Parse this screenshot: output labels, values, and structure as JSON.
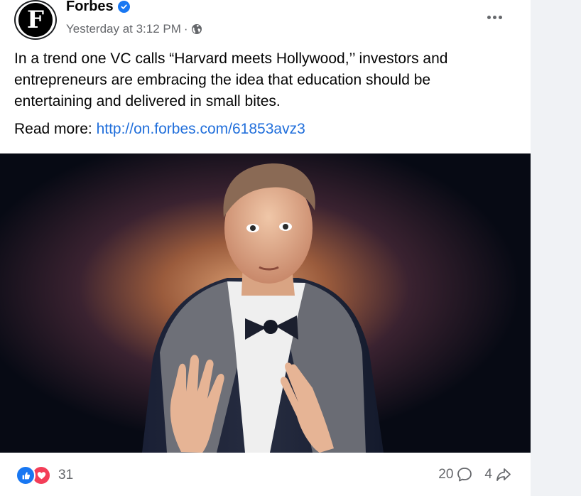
{
  "post": {
    "page_name": "Forbes",
    "avatar_letter": "F",
    "timestamp": "Yesterday at 3:12 PM",
    "separator": "·",
    "audience_icon": "globe-icon",
    "text": "In a trend one VC calls “Harvard meets Hollywood,’’ investors and entrepreneurs are embracing the idea that education should be entertaining and delivered in small bites.",
    "read_more_label": "Read more: ",
    "link": "http://on.forbes.com/61853avz3"
  },
  "footer": {
    "reaction_count": "31",
    "comment_count": "20",
    "share_count": "4"
  },
  "colors": {
    "link": "#216fdb",
    "like": "#1877f2",
    "love": "#f33e58",
    "muted": "#65676b"
  }
}
